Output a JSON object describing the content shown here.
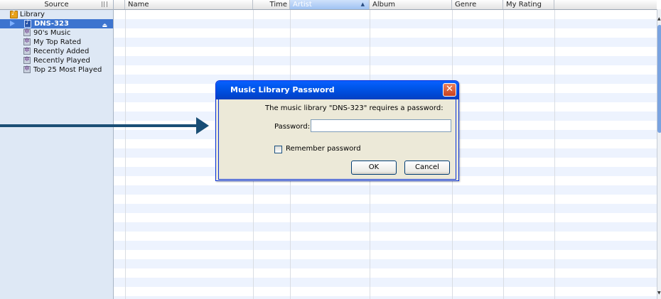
{
  "source_panel": {
    "header": "Source",
    "items": [
      {
        "label": "Library",
        "icon": "library-icon"
      },
      {
        "label": "DNS-323",
        "icon": "shared-library-icon",
        "selected": true
      },
      {
        "label": "90's Music",
        "icon": "smart-playlist-icon"
      },
      {
        "label": "My Top Rated",
        "icon": "smart-playlist-icon"
      },
      {
        "label": "Recently Added",
        "icon": "smart-playlist-icon"
      },
      {
        "label": "Recently Played",
        "icon": "smart-playlist-icon"
      },
      {
        "label": "Top 25 Most Played",
        "icon": "smart-playlist-icon"
      }
    ]
  },
  "columns": {
    "name": "Name",
    "time": "Time",
    "artist": "Artist",
    "album": "Album",
    "genre": "Genre",
    "my_rating": "My Rating"
  },
  "sorted_column": "Artist",
  "dialog": {
    "title": "Music Library Password",
    "message": "The music library \"DNS-323\" requires a password:",
    "password_label": "Password:",
    "password_value": "",
    "remember_label": "Remember password",
    "remember_checked": false,
    "ok_label": "OK",
    "cancel_label": "Cancel"
  },
  "colors": {
    "selection": "#3d74cf",
    "arrow": "#1b4f75",
    "title_bar": "#0058ee"
  }
}
